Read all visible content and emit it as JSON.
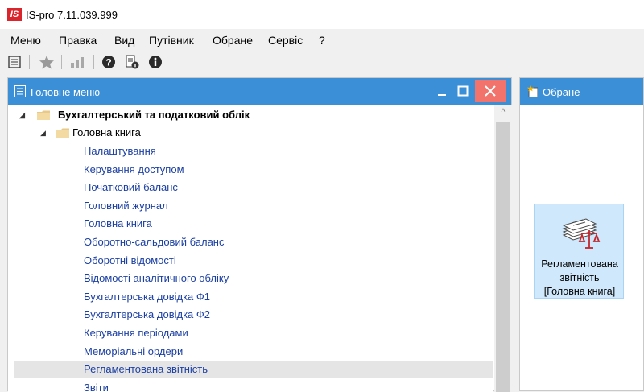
{
  "window": {
    "title": "IS-pro 7.11.039.999",
    "logo_text": "IS"
  },
  "menu": [
    "Меню",
    "Правка",
    "Вид",
    "Путівник",
    "Обране",
    "Сервіс",
    "?"
  ],
  "toolbar": {
    "icons": [
      "list-icon",
      "star-icon",
      "chart-icon",
      "help-icon",
      "doc-info-icon",
      "info-icon"
    ]
  },
  "main_panel": {
    "title": "Головне меню",
    "buttons": {
      "minimize": "_",
      "maximize": "□",
      "close": "✕"
    }
  },
  "tree": {
    "root": "Бухгалтерський та податковий облік",
    "group": "Головна книга",
    "items": [
      "Налаштування",
      "Керування доступом",
      "Початковий баланс",
      "Головний журнал",
      "Головна книга",
      "Оборотно-сальдовий баланс",
      "Оборотні відомості",
      "Відомості аналітичного обліку",
      "Бухгалтерська довідка Ф1",
      "Бухгалтерська довідка Ф2",
      "Керування періодами",
      "Меморіальні ордери",
      "Регламентована звітність",
      "Звіти"
    ],
    "selected_index": 12
  },
  "favorites_panel": {
    "title": "Обране",
    "item": {
      "line1": "Регламентована",
      "line2": "звітність",
      "line3": "[Головна книга]"
    }
  },
  "colors": {
    "header_blue": "#3b8fd6",
    "close_red": "#f2736b",
    "link_blue": "#1b3fa3",
    "fav_tile": "#cfe8fb"
  }
}
